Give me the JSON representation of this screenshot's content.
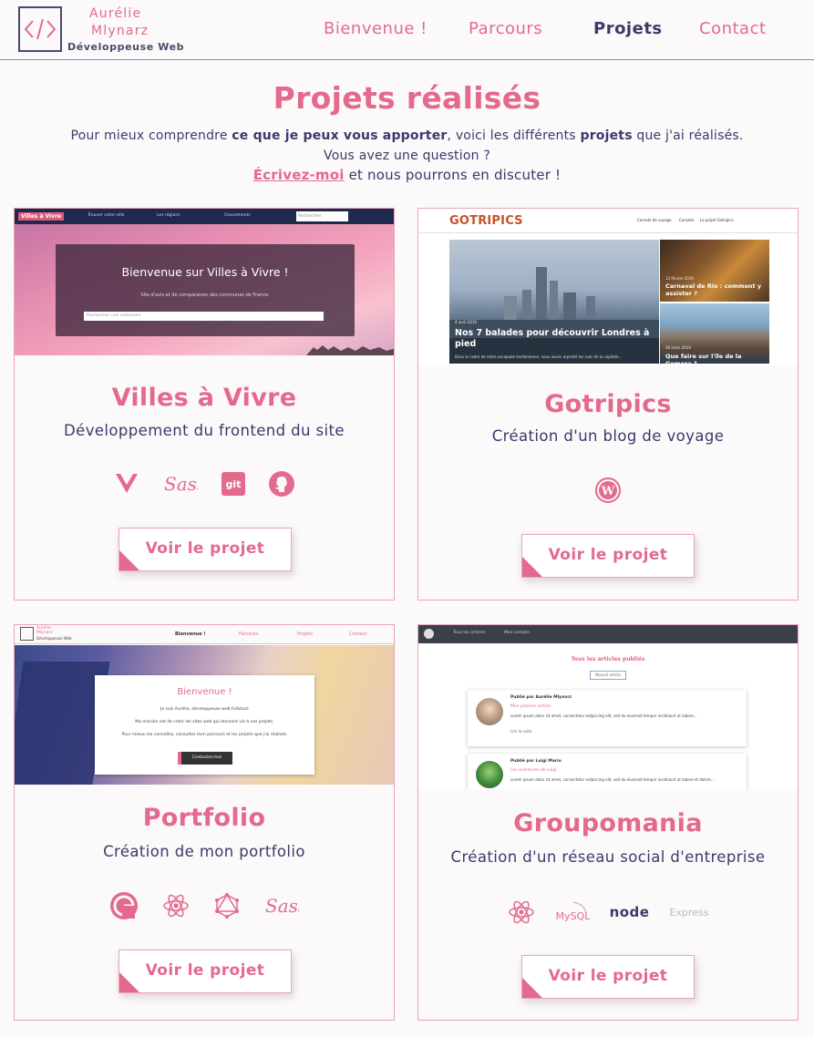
{
  "header": {
    "brand_name_line1": "Aurélie",
    "brand_name_line2": "Mlynarz",
    "brand_role": "Développeuse Web",
    "nav": [
      {
        "label": "Bienvenue !",
        "active": false
      },
      {
        "label": "Parcours",
        "active": false
      },
      {
        "label": "Projets",
        "active": true
      },
      {
        "label": "Contact",
        "active": false
      }
    ]
  },
  "intro": {
    "title": "Projets réalisés",
    "line1_a": "Pour mieux comprendre ",
    "line1_b": "ce que je peux vous apporter",
    "line1_c": ", voici les différents ",
    "line1_d": "projets",
    "line1_e": " que j'ai réalisés.",
    "line2": "Vous avez une question ?",
    "line3_link": "Écrivez-moi",
    "line3_rest": " et nous pourrons en discuter !"
  },
  "projects": [
    {
      "title": "Villes à Vivre",
      "desc": "Développement du frontend du site",
      "tech": [
        "vue-icon",
        "sass-icon",
        "git-icon",
        "github-icon"
      ],
      "button": "Voir le projet",
      "shot": {
        "brand": "Villes à Vivre",
        "menu": [
          "Trouver votre ville",
          "Les régions",
          "Classements"
        ],
        "search_btn": "Rechercher",
        "hero_title": "Bienvenue sur Villes à Vivre !",
        "hero_sub": "Site d'avis et de comparaison des communes de France.",
        "hero_input": "Rechercher une commune"
      }
    },
    {
      "title": "Gotripics",
      "desc": "Création d'un blog de voyage",
      "tech": [
        "wordpress-icon"
      ],
      "button": "Voir le projet",
      "shot": {
        "brand": "GOTRIPICS",
        "menu": [
          "Carnets de voyage",
          "Conseils",
          "Le projet Gotripics"
        ],
        "main_date": "4 avril 2019",
        "main_title": "Nos 7 balades pour découvrir Londres à pied",
        "main_excerpt": "Dans le cadre de notre escapade londonienne, nous avons arpenté les rues de la capitale…",
        "side1_date": "13 février 2019",
        "side1_title": "Carnaval de Rio : comment y assister ?",
        "side2_date": "26 mars 2019",
        "side2_title": "Que faire sur l'île de la Gomera ?"
      }
    },
    {
      "title": "Portfolio",
      "desc": "Création de mon portfolio",
      "tech": [
        "gatsby-icon",
        "react-icon",
        "graphql-icon",
        "sass-icon"
      ],
      "button": "Voir le projet",
      "shot": {
        "brand1": "Aurélie",
        "brand2": "Mlynarz",
        "brand3": "Développeuse Web",
        "menu": [
          "Bienvenue !",
          "Parcours",
          "Projets",
          "Contact"
        ],
        "hero_title": "Bienvenue !",
        "line1": "Je suis Aurélie, développeuse web fullstack",
        "line2": "Ma mission est de créer les sites web qui donnent vie à vos projets.",
        "line3": "Pour mieux me connaître, consultez mon parcours et les projets que j'ai réalisés.",
        "button": "Contactez-moi"
      }
    },
    {
      "title": "Groupomania",
      "desc": "Création d'un réseau social d'entreprise",
      "tech": [
        "react-icon",
        "mysql-icon",
        "node-icon",
        "express-icon"
      ],
      "tech_labels": {
        "mysql": "MySQL",
        "node": "node",
        "express": "Express"
      },
      "button": "Voir le projet",
      "shot": {
        "menu": [
          "Tous les articles",
          "Mon compte"
        ],
        "heading": "Tous les articles publiés",
        "new_btn": "Nouvel article",
        "post1_author": "Publié par Aurélie Mlynarz",
        "post1_title": "Mon premier article",
        "post1_text": "Lorem ipsum dolor sit amet, consectetur adipiscing elit, sed do eiusmod tempor incididunt ut labore…",
        "post1_more": "Lire la suite",
        "post2_author": "Publié par Luigi Mario",
        "post2_title": "Les aventures de Luigi",
        "post2_text": "Lorem ipsum dolor sit amet, consectetur adipiscing elit, sed do eiusmod tempor incididunt ut labore et dolore…"
      }
    }
  ],
  "colors": {
    "accent": "#e36a8c",
    "text": "#3a3a6b",
    "background": "#fcf9fa",
    "border": "#e8a5b9"
  }
}
